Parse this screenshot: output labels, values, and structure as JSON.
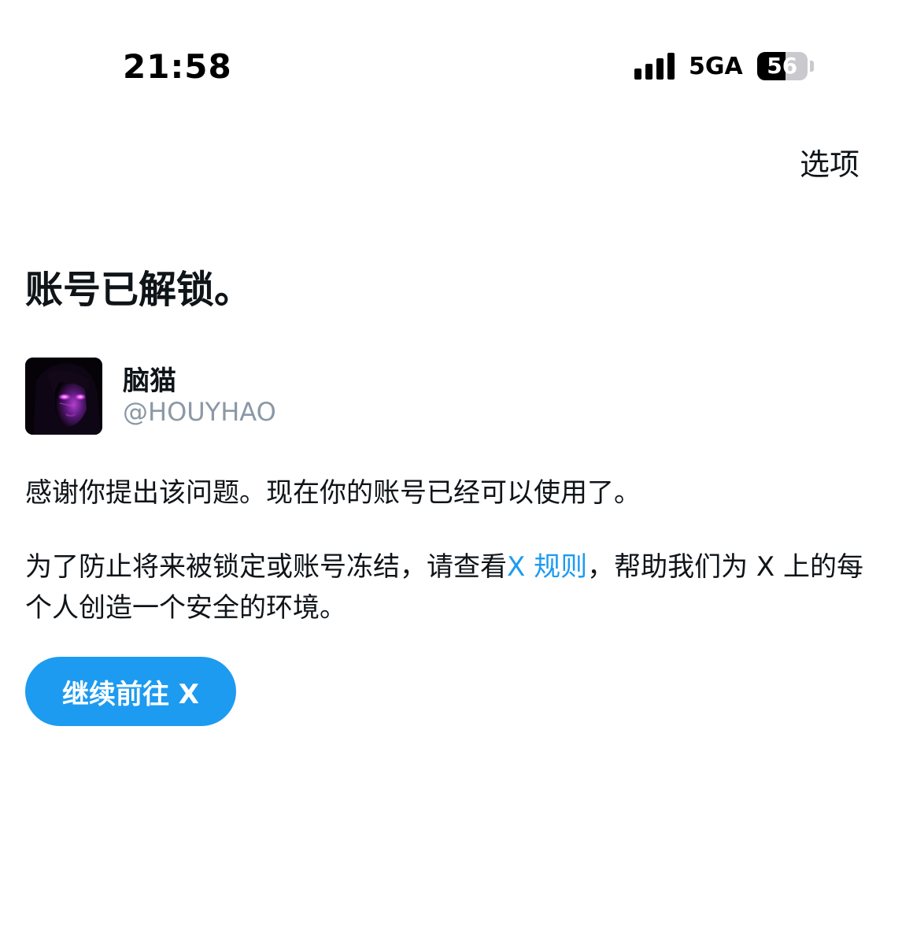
{
  "status_bar": {
    "time": "21:58",
    "network": "5GA",
    "battery_level": "56",
    "battery_fraction": 0.56,
    "signal_bars": 4
  },
  "header": {
    "options_label": "选项"
  },
  "main": {
    "title": "账号已解锁。",
    "user": {
      "display_name": "脑猫",
      "username": "@HOUYHAO"
    },
    "message_1": "感谢你提出该问题。现在你的账号已经可以使用了。",
    "message_2": {
      "before_link": "为了防止将来被锁定或账号冻结，请查看",
      "link_text": "X 规则",
      "after_link": "，帮助我们为 X 上的每个人创造一个安全的环境。"
    },
    "continue_button_label": "继续前往 X"
  },
  "colors": {
    "accent": "#1d9bf0",
    "text_primary": "#0f1419",
    "text_secondary": "#8b98a5",
    "avatar_glow": "#c23bd4"
  }
}
